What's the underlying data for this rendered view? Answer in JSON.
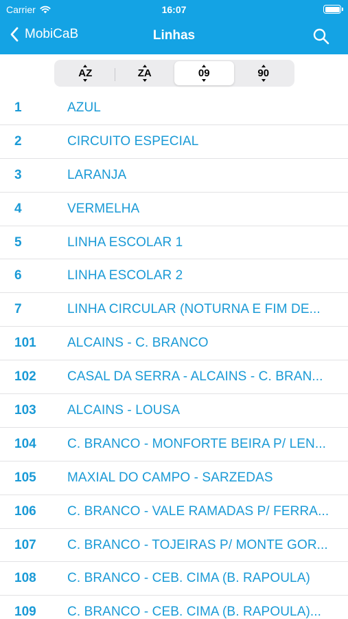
{
  "status": {
    "carrier": "Carrier",
    "time": "16:07"
  },
  "nav": {
    "back_label": "MobiCaB",
    "title": "Linhas"
  },
  "sort": {
    "options": [
      {
        "label": "AZ",
        "active": false
      },
      {
        "label": "ZA",
        "active": false
      },
      {
        "label": "09",
        "active": true
      },
      {
        "label": "90",
        "active": false
      }
    ]
  },
  "lines": [
    {
      "number": "1",
      "name": "AZUL"
    },
    {
      "number": "2",
      "name": "CIRCUITO ESPECIAL"
    },
    {
      "number": "3",
      "name": "LARANJA"
    },
    {
      "number": "4",
      "name": "VERMELHA"
    },
    {
      "number": "5",
      "name": "LINHA ESCOLAR 1"
    },
    {
      "number": "6",
      "name": "LINHA ESCOLAR 2"
    },
    {
      "number": "7",
      "name": "LINHA CIRCULAR (NOTURNA E FIM DE..."
    },
    {
      "number": "101",
      "name": "ALCAINS - C. BRANCO"
    },
    {
      "number": "102",
      "name": "CASAL DA SERRA - ALCAINS - C. BRAN..."
    },
    {
      "number": "103",
      "name": "ALCAINS - LOUSA"
    },
    {
      "number": "104",
      "name": "C. BRANCO - MONFORTE BEIRA P/ LEN..."
    },
    {
      "number": "105",
      "name": "MAXIAL DO CAMPO - SARZEDAS"
    },
    {
      "number": "106",
      "name": "C. BRANCO - VALE RAMADAS P/ FERRA..."
    },
    {
      "number": "107",
      "name": "C. BRANCO - TOJEIRAS P/ MONTE GOR..."
    },
    {
      "number": "108",
      "name": "C. BRANCO - CEB. CIMA (B. RAPOULA)"
    },
    {
      "number": "109",
      "name": "C. BRANCO - CEB. CIMA (B. RAPOULA)..."
    }
  ],
  "colors": {
    "accent": "#14a3e4",
    "link": "#1a9ad6"
  }
}
